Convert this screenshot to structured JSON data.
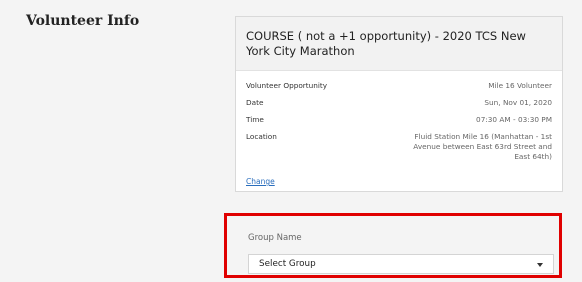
{
  "section": {
    "title": "Volunteer Info"
  },
  "card": {
    "title": "COURSE ( not a +1 opportunity) - 2020 TCS New York City Marathon",
    "rows": [
      {
        "label": "Volunteer Opportunity",
        "value": "Mile 16 Volunteer"
      },
      {
        "label": "Date",
        "value": "Sun, Nov 01, 2020"
      },
      {
        "label": "Time",
        "value": "07:30 AM - 03:30 PM"
      },
      {
        "label": "Location",
        "value": "Fluid Station Mile 16 (Manhattan - 1st Avenue between East 63rd Street and East 64th)"
      }
    ],
    "change_label": "Change"
  },
  "group": {
    "label": "Group Name",
    "selected": "Select Group"
  },
  "colors": {
    "highlight": "#e00000",
    "link": "#2a6ebd"
  },
  "icons": {
    "dropdown": "caret-down-icon"
  }
}
